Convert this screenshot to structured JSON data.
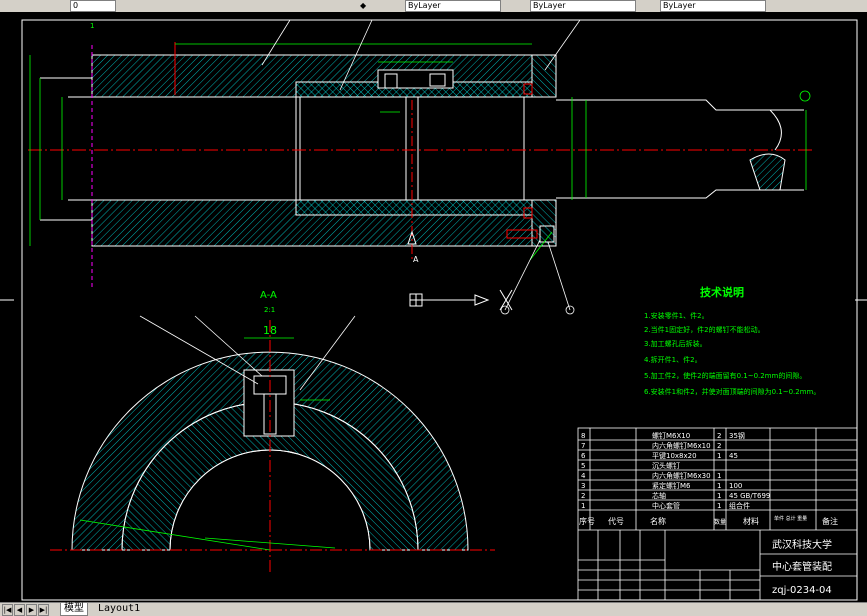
{
  "topbar": {
    "layer_value": "0",
    "combo1": "ByLayer",
    "combo2": "ByLayer",
    "combo3": "ByLayer"
  },
  "tabs": {
    "model": "模型",
    "layout1": "Layout1"
  },
  "drawing": {
    "dim_top": "1",
    "section_title": "A-A",
    "section_scale": "2:1",
    "section_width_dim": "18",
    "section_label": "A",
    "notes_title": "技术说明",
    "notes": [
      "1.安装零件1、件2。",
      "2.当件1固定好，件2的螺钉不能松动。",
      "3.加工螺孔后拆装。",
      "4.拆开件1、件2。",
      "5.加工件2，使件2的端面留有0.1~0.2mm的间隙。",
      "6.安装件1和件2，并使对面顶端的间隙为0.1~0.2mm。"
    ]
  },
  "titleblock": {
    "header": [
      "序号",
      "代号",
      "名称",
      "数量",
      "材料",
      "单件 总计 重量",
      "备注"
    ],
    "rows": [
      [
        "8",
        "螺钉M6X10",
        "2",
        "35钢"
      ],
      [
        "7",
        "内六角螺钉M6x10",
        "2",
        ""
      ],
      [
        "6",
        "平键10x8x20",
        "1",
        "45"
      ],
      [
        "5",
        "沉头螺钉",
        "",
        ""
      ],
      [
        "4",
        "内六角螺钉M6x30",
        "1",
        ""
      ],
      [
        "3",
        "紧定螺钉M6",
        "1",
        "100"
      ],
      [
        "2",
        "芯轴",
        "1",
        "45 GB/T699"
      ],
      [
        "1",
        "中心套管",
        "1",
        "组合件"
      ]
    ],
    "school": "武汉科技大学",
    "drawing_name": "中心套管装配",
    "drawing_no": "zqj-0234-04"
  },
  "colors": {
    "background": "#000000",
    "white_lines": "#ffffff",
    "hatch": "#00ffff",
    "center_lines": "#ff0000",
    "dimensions": "#00ff00",
    "notes_text": "#00ff00",
    "magenta": "#ff00ff"
  }
}
